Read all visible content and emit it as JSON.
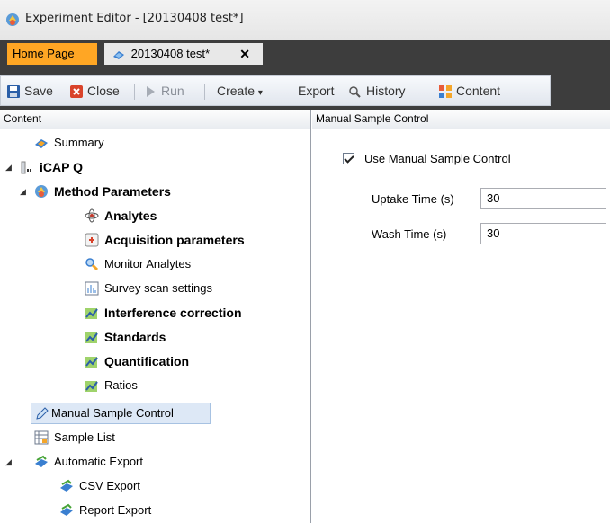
{
  "window": {
    "title": "Experiment Editor - [20130408 test*]"
  },
  "tabs": {
    "home": "Home Page",
    "document": "20130408 test*",
    "close_glyph": "✕"
  },
  "toolbar": {
    "save": "Save",
    "close": "Close",
    "run": "Run",
    "create": "Create",
    "create_arrow": "▾",
    "export": "Export",
    "history": "History",
    "content": "Content"
  },
  "left_pane": {
    "header": "Content",
    "tree": {
      "summary": "Summary",
      "icapq": "iCAP Q",
      "method_parameters": "Method Parameters",
      "analytes": "Analytes",
      "acquisition_parameters": "Acquisition parameters",
      "monitor_analytes": "Monitor Analytes",
      "survey_scan_settings": "Survey scan settings",
      "interference_correction": "Interference correction",
      "standards": "Standards",
      "quantification": "Quantification",
      "ratios": "Ratios",
      "manual_sample_control": "Manual Sample Control",
      "sample_list": "Sample List",
      "automatic_export": "Automatic Export",
      "csv_export": "CSV Export",
      "report_export": "Report Export"
    },
    "expanded_glyph": "◢"
  },
  "right_pane": {
    "header": "Manual Sample Control",
    "use_manual_label": "Use Manual Sample Control",
    "use_manual_checked": true,
    "uptake_label": "Uptake Time (s)",
    "uptake_value": "30",
    "wash_label": "Wash Time (s)",
    "wash_value": "30"
  },
  "icons": {
    "app": "app-icon",
    "save": "floppy-icon",
    "close": "close-icon",
    "run": "play-icon",
    "history": "history-icon",
    "content": "content-icon"
  },
  "colors": {
    "home_tab": "#ffa624",
    "tab_bar": "#3d3d3d",
    "selection": "#dde8f6"
  }
}
